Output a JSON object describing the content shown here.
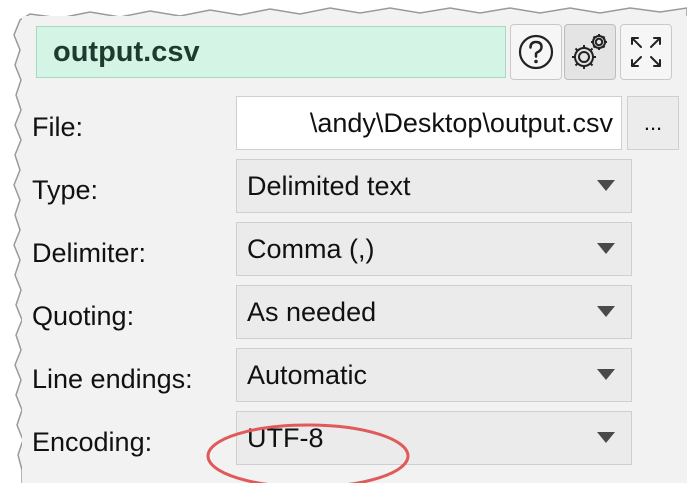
{
  "title": "output.csv",
  "toolbar": {
    "help_icon": "help-circle-icon",
    "settings_icon": "gears-icon",
    "expand_icon": "expand-icon"
  },
  "file": {
    "label": "File:",
    "value": "\\andy\\Desktop\\output.csv",
    "browse_label": "..."
  },
  "type": {
    "label": "Type:",
    "value": "Delimited text"
  },
  "delimiter": {
    "label": "Delimiter:",
    "value": "Comma (,)"
  },
  "quoting": {
    "label": "Quoting:",
    "value": "As needed"
  },
  "line_endings": {
    "label": "Line endings:",
    "value": "Automatic"
  },
  "encoding": {
    "label": "Encoding:",
    "value": "UTF-8"
  },
  "colors": {
    "title_bg": "#d4f5e6",
    "highlight": "#e05a5a",
    "dropdown_bg": "#ebebeb"
  }
}
